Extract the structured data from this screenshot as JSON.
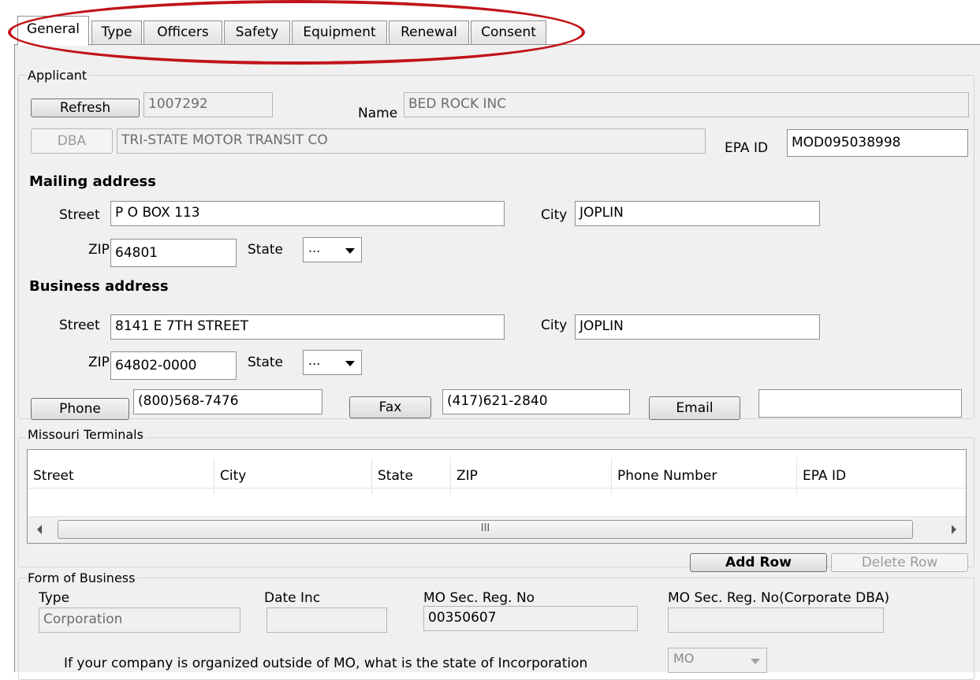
{
  "tabs": [
    {
      "label": "General",
      "active": true
    },
    {
      "label": "Type"
    },
    {
      "label": "Officers"
    },
    {
      "label": "Safety"
    },
    {
      "label": "Equipment"
    },
    {
      "label": "Renewal"
    },
    {
      "label": "Consent"
    }
  ],
  "applicant": {
    "group_title": "Applicant",
    "refresh_label": "Refresh",
    "id_value": "1007292",
    "name_label": "Name",
    "name_value": "BED ROCK INC",
    "dba_label": "DBA",
    "dba_value": "TRI-STATE MOTOR TRANSIT CO",
    "epa_label": "EPA ID",
    "epa_value": "MOD095038998"
  },
  "mailing": {
    "heading": "Mailing address",
    "street_label": "Street",
    "street_value": "P O BOX 113",
    "city_label": "City",
    "city_value": "JOPLIN",
    "zip_label": "ZIP",
    "zip_value": "64801",
    "state_label": "State",
    "state_value": "..."
  },
  "business": {
    "heading": "Business address",
    "street_label": "Street",
    "street_value": "8141 E 7TH STREET",
    "city_label": "City",
    "city_value": "JOPLIN",
    "zip_label": "ZIP",
    "zip_value": "64802-0000",
    "state_label": "State",
    "state_value": "..."
  },
  "contact": {
    "phone_label": "Phone",
    "phone_value": "(800)568-7476",
    "fax_label": "Fax",
    "fax_value": "(417)621-2840",
    "email_label": "Email",
    "email_value": ""
  },
  "terminals": {
    "group_title": "Missouri Terminals",
    "columns": [
      "Street",
      "City",
      "State",
      "ZIP",
      "Phone Number",
      "EPA ID"
    ],
    "scroll_grip": "III",
    "add_row_label": "Add Row",
    "delete_row_label": "Delete Row"
  },
  "form_of_business": {
    "group_title": "Form of Business",
    "type_label": "Type",
    "type_value": "Corporation",
    "date_inc_label": "Date Inc",
    "date_inc_value": "",
    "mo_sec_label": "MO Sec. Reg. No",
    "mo_sec_value": "00350607",
    "mo_sec_dba_label": "MO Sec. Reg. No(Corporate DBA)",
    "mo_sec_dba_value": "",
    "incorporation_question": "If your company is organized outside of MO, what is the state of Incorporation",
    "incorporation_state": "MO"
  },
  "colors": {
    "highlight": "#c0141a",
    "panel_bg": "#f0f0f0"
  }
}
